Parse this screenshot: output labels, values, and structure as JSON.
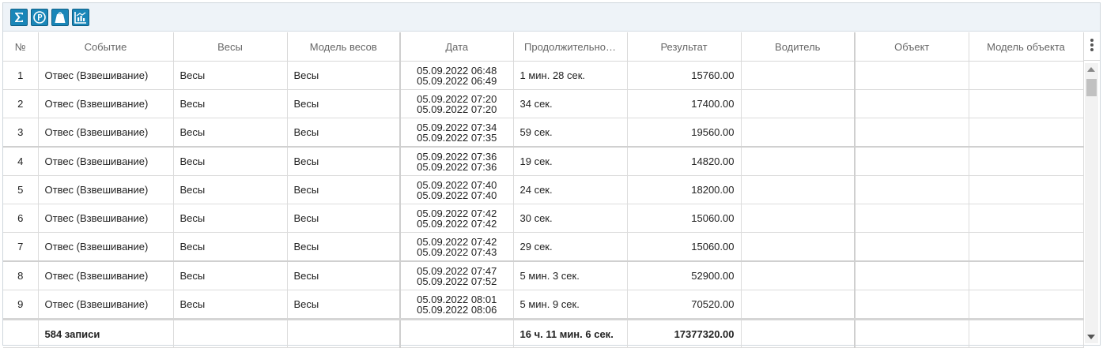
{
  "toolbar": {
    "buttons": [
      {
        "name": "sum-icon",
        "color": "#1a86b8"
      },
      {
        "name": "parking-icon",
        "color": "#1a86b8"
      },
      {
        "name": "weight-icon",
        "color": "#1a86b8"
      },
      {
        "name": "report-chart-icon",
        "color": "#1a86b8"
      }
    ]
  },
  "columns": {
    "num": "№",
    "event": "Событие",
    "scales": "Весы",
    "scales_model": "Модель весов",
    "date": "Дата",
    "duration": "Продолжительно…",
    "result": "Результат",
    "driver": "Водитель",
    "object": "Объект",
    "object_model": "Модель объекта"
  },
  "rows": [
    {
      "num": "1",
      "event": "Отвес (Взвешивание)",
      "scales": "Весы",
      "scales_model": "Весы",
      "date_start": "05.09.2022 06:48",
      "date_end": "05.09.2022 06:49",
      "duration": "1 мин. 28 сек.",
      "result": "15760.00",
      "driver": "",
      "object": "",
      "object_model": ""
    },
    {
      "num": "2",
      "event": "Отвес (Взвешивание)",
      "scales": "Весы",
      "scales_model": "Весы",
      "date_start": "05.09.2022 07:20",
      "date_end": "05.09.2022 07:20",
      "duration": "34 сек.",
      "result": "17400.00",
      "driver": "",
      "object": "",
      "object_model": ""
    },
    {
      "num": "3",
      "event": "Отвес (Взвешивание)",
      "scales": "Весы",
      "scales_model": "Весы",
      "date_start": "05.09.2022 07:34",
      "date_end": "05.09.2022 07:35",
      "duration": "59 сек.",
      "result": "19560.00",
      "driver": "",
      "object": "",
      "object_model": ""
    },
    {
      "num": "4",
      "event": "Отвес (Взвешивание)",
      "scales": "Весы",
      "scales_model": "Весы",
      "date_start": "05.09.2022 07:36",
      "date_end": "05.09.2022 07:36",
      "duration": "19 сек.",
      "result": "14820.00",
      "driver": "",
      "object": "",
      "object_model": ""
    },
    {
      "num": "5",
      "event": "Отвес (Взвешивание)",
      "scales": "Весы",
      "scales_model": "Весы",
      "date_start": "05.09.2022 07:40",
      "date_end": "05.09.2022 07:40",
      "duration": "24 сек.",
      "result": "18200.00",
      "driver": "",
      "object": "",
      "object_model": ""
    },
    {
      "num": "6",
      "event": "Отвес (Взвешивание)",
      "scales": "Весы",
      "scales_model": "Весы",
      "date_start": "05.09.2022 07:42",
      "date_end": "05.09.2022 07:42",
      "duration": "30 сек.",
      "result": "15060.00",
      "driver": "",
      "object": "",
      "object_model": ""
    },
    {
      "num": "7",
      "event": "Отвес (Взвешивание)",
      "scales": "Весы",
      "scales_model": "Весы",
      "date_start": "05.09.2022 07:42",
      "date_end": "05.09.2022 07:43",
      "duration": "29 сек.",
      "result": "15060.00",
      "driver": "",
      "object": "",
      "object_model": ""
    },
    {
      "num": "8",
      "event": "Отвес (Взвешивание)",
      "scales": "Весы",
      "scales_model": "Весы",
      "date_start": "05.09.2022 07:47",
      "date_end": "05.09.2022 07:52",
      "duration": "5 мин. 3 сек.",
      "result": "52900.00",
      "driver": "",
      "object": "",
      "object_model": ""
    },
    {
      "num": "9",
      "event": "Отвес (Взвешивание)",
      "scales": "Весы",
      "scales_model": "Весы",
      "date_start": "05.09.2022 08:01",
      "date_end": "05.09.2022 08:06",
      "duration": "5 мин. 9 сек.",
      "result": "70520.00",
      "driver": "",
      "object": "",
      "object_model": ""
    }
  ],
  "footer": {
    "records": "584 записи",
    "total_duration": "16 ч. 11 мин. 6 сек.",
    "total_result": "17377320.00"
  },
  "column_menu_icon": "vertical-dots-icon"
}
